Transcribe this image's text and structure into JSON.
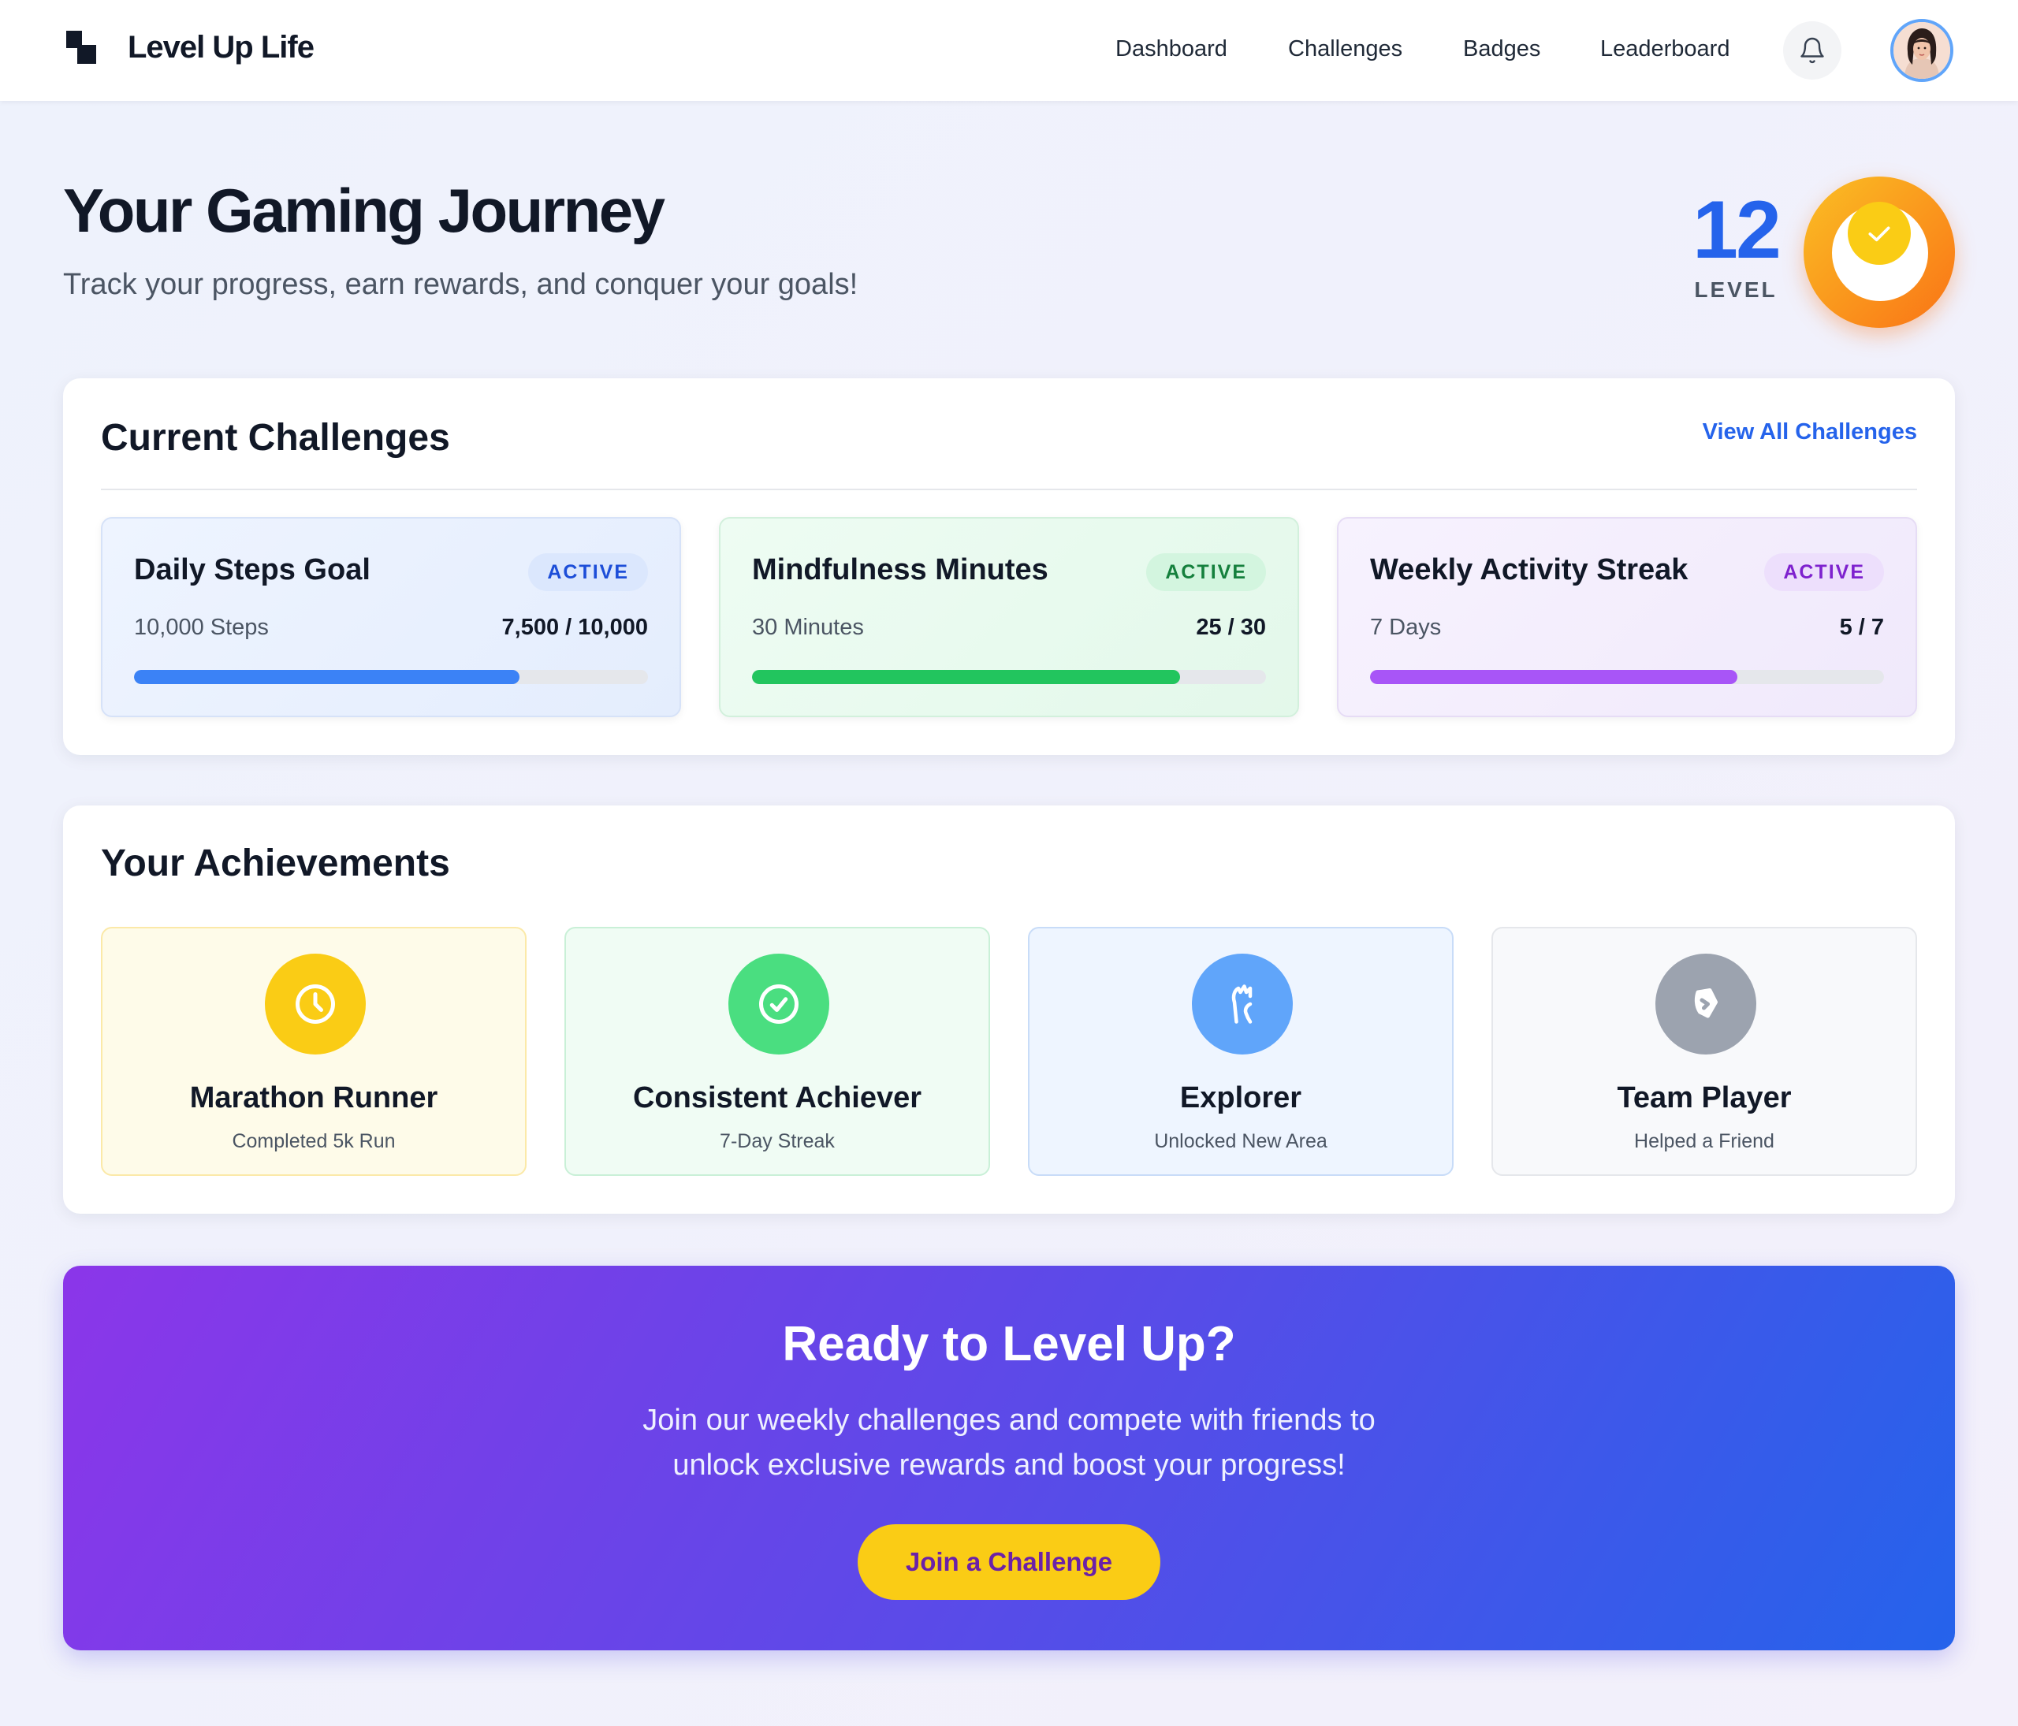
{
  "app": {
    "name": "Level Up Life"
  },
  "nav": {
    "items": [
      "Dashboard",
      "Challenges",
      "Badges",
      "Leaderboard"
    ]
  },
  "icons": {
    "bell": "bell-icon",
    "avatar": "user-avatar",
    "logo": "brand-logo-icon"
  },
  "hero": {
    "title": "Your Gaming Journey",
    "subtitle": "Track your progress, earn rewards, and conquer your goals!",
    "level_value": "12",
    "level_label": "LEVEL"
  },
  "challenges": {
    "title": "Current Challenges",
    "view_all": "View All Challenges",
    "items": [
      {
        "title": "Daily Steps Goal",
        "status": "ACTIVE",
        "target": "10,000 Steps",
        "progress": "7,500 / 10,000",
        "fraction": 0.75,
        "theme": "blue"
      },
      {
        "title": "Mindfulness Minutes",
        "status": "ACTIVE",
        "target": "30 Minutes",
        "progress": "25 / 30",
        "fraction": 0.833,
        "theme": "green"
      },
      {
        "title": "Weekly Activity Streak",
        "status": "ACTIVE",
        "target": "7 Days",
        "progress": "5 / 7",
        "fraction": 0.714,
        "theme": "purple"
      }
    ]
  },
  "achievements": {
    "title": "Your Achievements",
    "items": [
      {
        "title": "Marathon Runner",
        "desc": "Completed 5k Run",
        "icon": "clock-icon",
        "color": "#facc15"
      },
      {
        "title": "Consistent Achiever",
        "desc": "7-Day Streak",
        "icon": "check-circle-icon",
        "color": "#4ade80"
      },
      {
        "title": "Explorer",
        "desc": "Unlocked New Area",
        "icon": "map-icon",
        "color": "#60a5fa"
      },
      {
        "title": "Team Player",
        "desc": "Helped a Friend",
        "icon": "handshake-icon",
        "color": "#9ca3af"
      }
    ]
  },
  "cta": {
    "title": "Ready to Level Up?",
    "text": "Join our weekly challenges and compete with friends to unlock exclusive rewards and boost your progress!",
    "button": "Join a Challenge"
  },
  "colors": {
    "accent": "#2563eb",
    "level_badge_start": "#fbbf24",
    "level_badge_end": "#f97316",
    "cta_start": "#8b36e9",
    "cta_end": "#2563eb",
    "cta_button": "#facc15"
  }
}
